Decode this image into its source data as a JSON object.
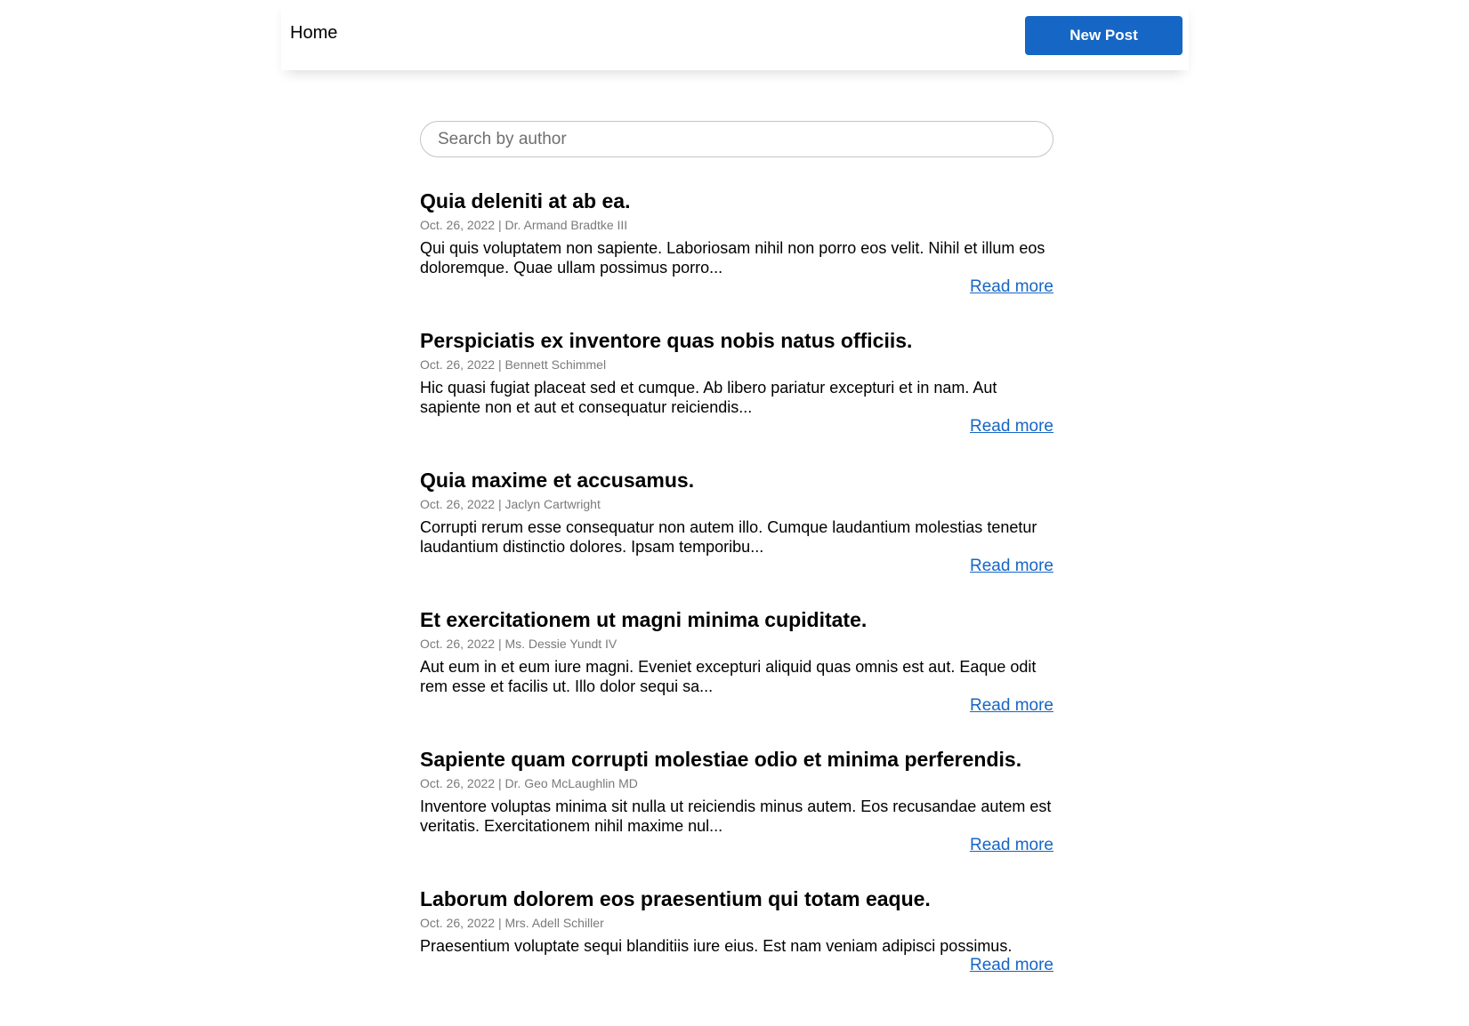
{
  "header": {
    "home_label": "Home",
    "new_post_label": "New Post"
  },
  "search": {
    "placeholder": "Search by author",
    "value": ""
  },
  "colors": {
    "accent": "#1666c5",
    "meta_text": "#7a7a7a",
    "border": "#c4c4c4"
  },
  "posts": [
    {
      "title": "Quia deleniti at ab ea.",
      "meta": "Oct. 26, 2022 | Dr. Armand Bradtke III",
      "excerpt": "Qui quis voluptatem non sapiente. Laboriosam nihil non porro eos velit. Nihil et illum eos doloremque. Quae ullam possimus porro...",
      "read_more": "Read more"
    },
    {
      "title": "Perspiciatis ex inventore quas nobis natus officiis.",
      "meta": "Oct. 26, 2022 | Bennett Schimmel",
      "excerpt": "Hic quasi fugiat placeat sed et cumque. Ab libero pariatur excepturi et in nam. Aut sapiente non et aut et consequatur reiciendis...",
      "read_more": "Read more"
    },
    {
      "title": "Quia maxime et accusamus.",
      "meta": "Oct. 26, 2022 | Jaclyn Cartwright",
      "excerpt": "Corrupti rerum esse consequatur non autem illo. Cumque laudantium molestias tenetur laudantium distinctio dolores. Ipsam temporibu...",
      "read_more": "Read more"
    },
    {
      "title": "Et exercitationem ut magni minima cupiditate.",
      "meta": "Oct. 26, 2022 | Ms. Dessie Yundt IV",
      "excerpt": "Aut eum in et eum iure magni. Eveniet excepturi aliquid quas omnis est aut. Eaque odit rem esse et facilis ut. Illo dolor sequi sa...",
      "read_more": "Read more"
    },
    {
      "title": "Sapiente quam corrupti molestiae odio et minima perferendis.",
      "meta": "Oct. 26, 2022 | Dr. Geo McLaughlin MD",
      "excerpt": "Inventore voluptas minima sit nulla ut reiciendis minus autem. Eos recusandae autem est veritatis. Exercitationem nihil maxime nul...",
      "read_more": "Read more"
    },
    {
      "title": "Laborum dolorem eos praesentium qui totam eaque.",
      "meta": "Oct. 26, 2022 | Mrs. Adell Schiller",
      "excerpt": "Praesentium voluptate sequi blanditiis iure eius. Est nam veniam adipisci possimus.",
      "read_more": "Read more"
    }
  ]
}
